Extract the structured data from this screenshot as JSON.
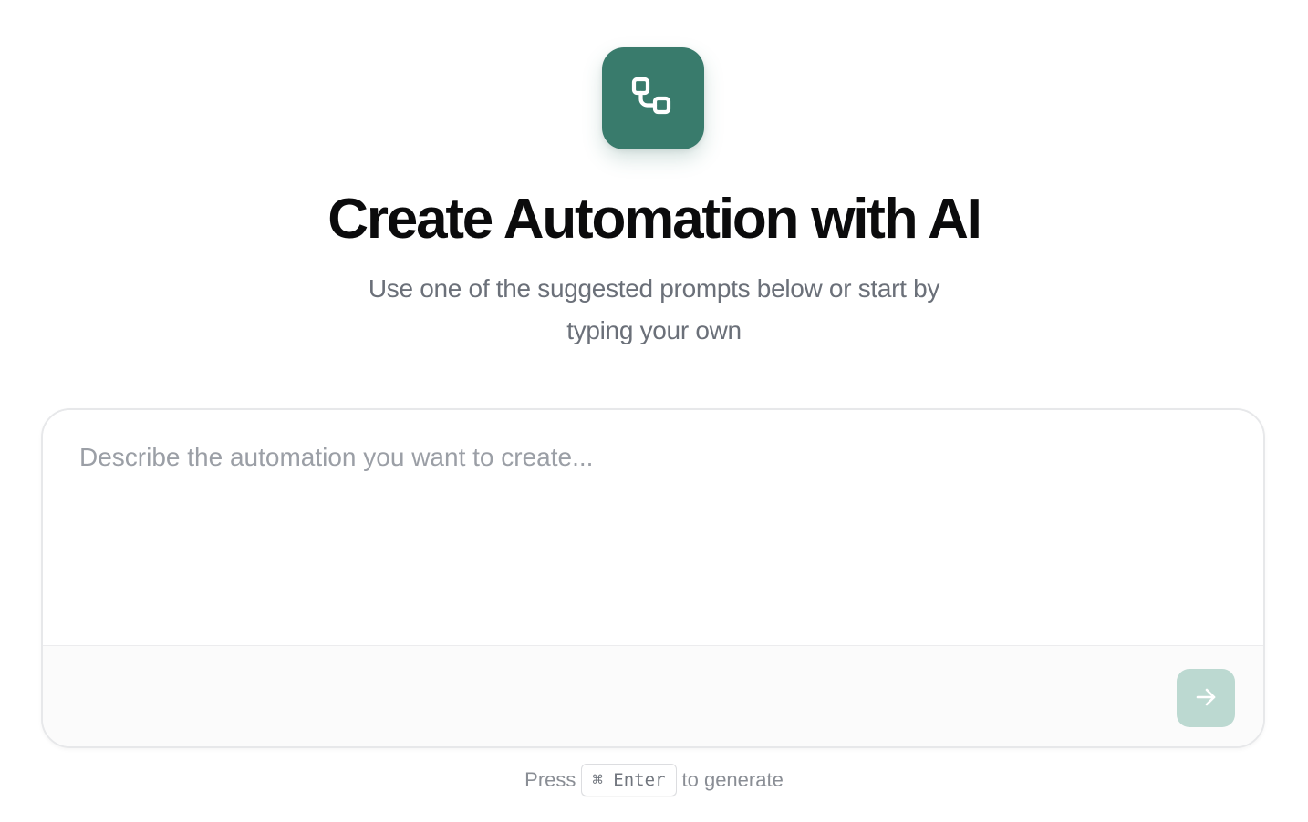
{
  "app": {
    "logo_icon": "workflow-icon",
    "accent_color": "#397b6c"
  },
  "header": {
    "title": "Create Automation with AI",
    "subtitle": "Use one of the suggested prompts below or start by typing your own"
  },
  "composer": {
    "placeholder": "Describe the automation you want to create...",
    "value": "",
    "submit_icon": "arrow-right-icon",
    "submit_color": "#bcd9d1"
  },
  "hint": {
    "prefix": "Press",
    "shortcut": "⌘ Enter",
    "suffix": "to generate"
  }
}
